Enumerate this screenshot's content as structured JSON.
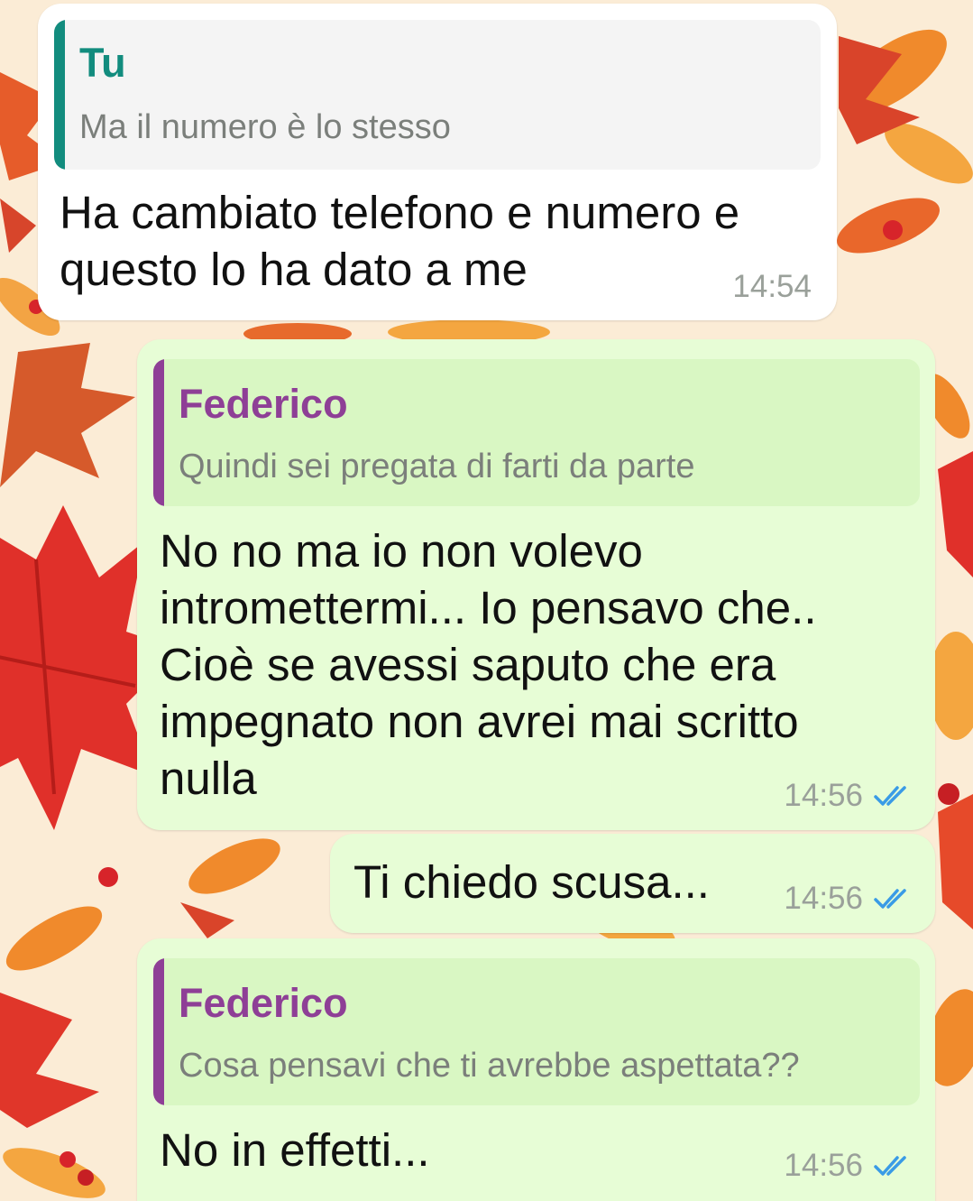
{
  "colors": {
    "quote_self": "#128c7e",
    "quote_contact": "#8e3f96",
    "read_ticks": "#3a9be6"
  },
  "messages": [
    {
      "quote_author": "Tu",
      "quote_text": "Ma il numero è lo stesso",
      "lines": [
        "Ha cambiato telefono e numero e",
        "questo lo ha dato a me"
      ],
      "time": "14:54"
    },
    {
      "quote_author": "Federico",
      "quote_text": "Quindi sei pregata di farti da parte",
      "lines": [
        "No no ma io non volevo",
        "intromettermi... Io pensavo che..",
        "Cioè se avessi saputo che era",
        "impegnato non avrei mai scritto",
        "nulla"
      ],
      "time": "14:56",
      "status_icon": "double-check-read-icon"
    },
    {
      "lines": [
        "Ti chiedo scusa..."
      ],
      "time": "14:56",
      "status_icon": "double-check-read-icon"
    },
    {
      "quote_author": "Federico",
      "quote_text": "Cosa pensavi che ti avrebbe aspettata??",
      "lines": [
        "No in effetti..."
      ],
      "time": "14:56",
      "status_icon": "double-check-read-icon"
    }
  ]
}
